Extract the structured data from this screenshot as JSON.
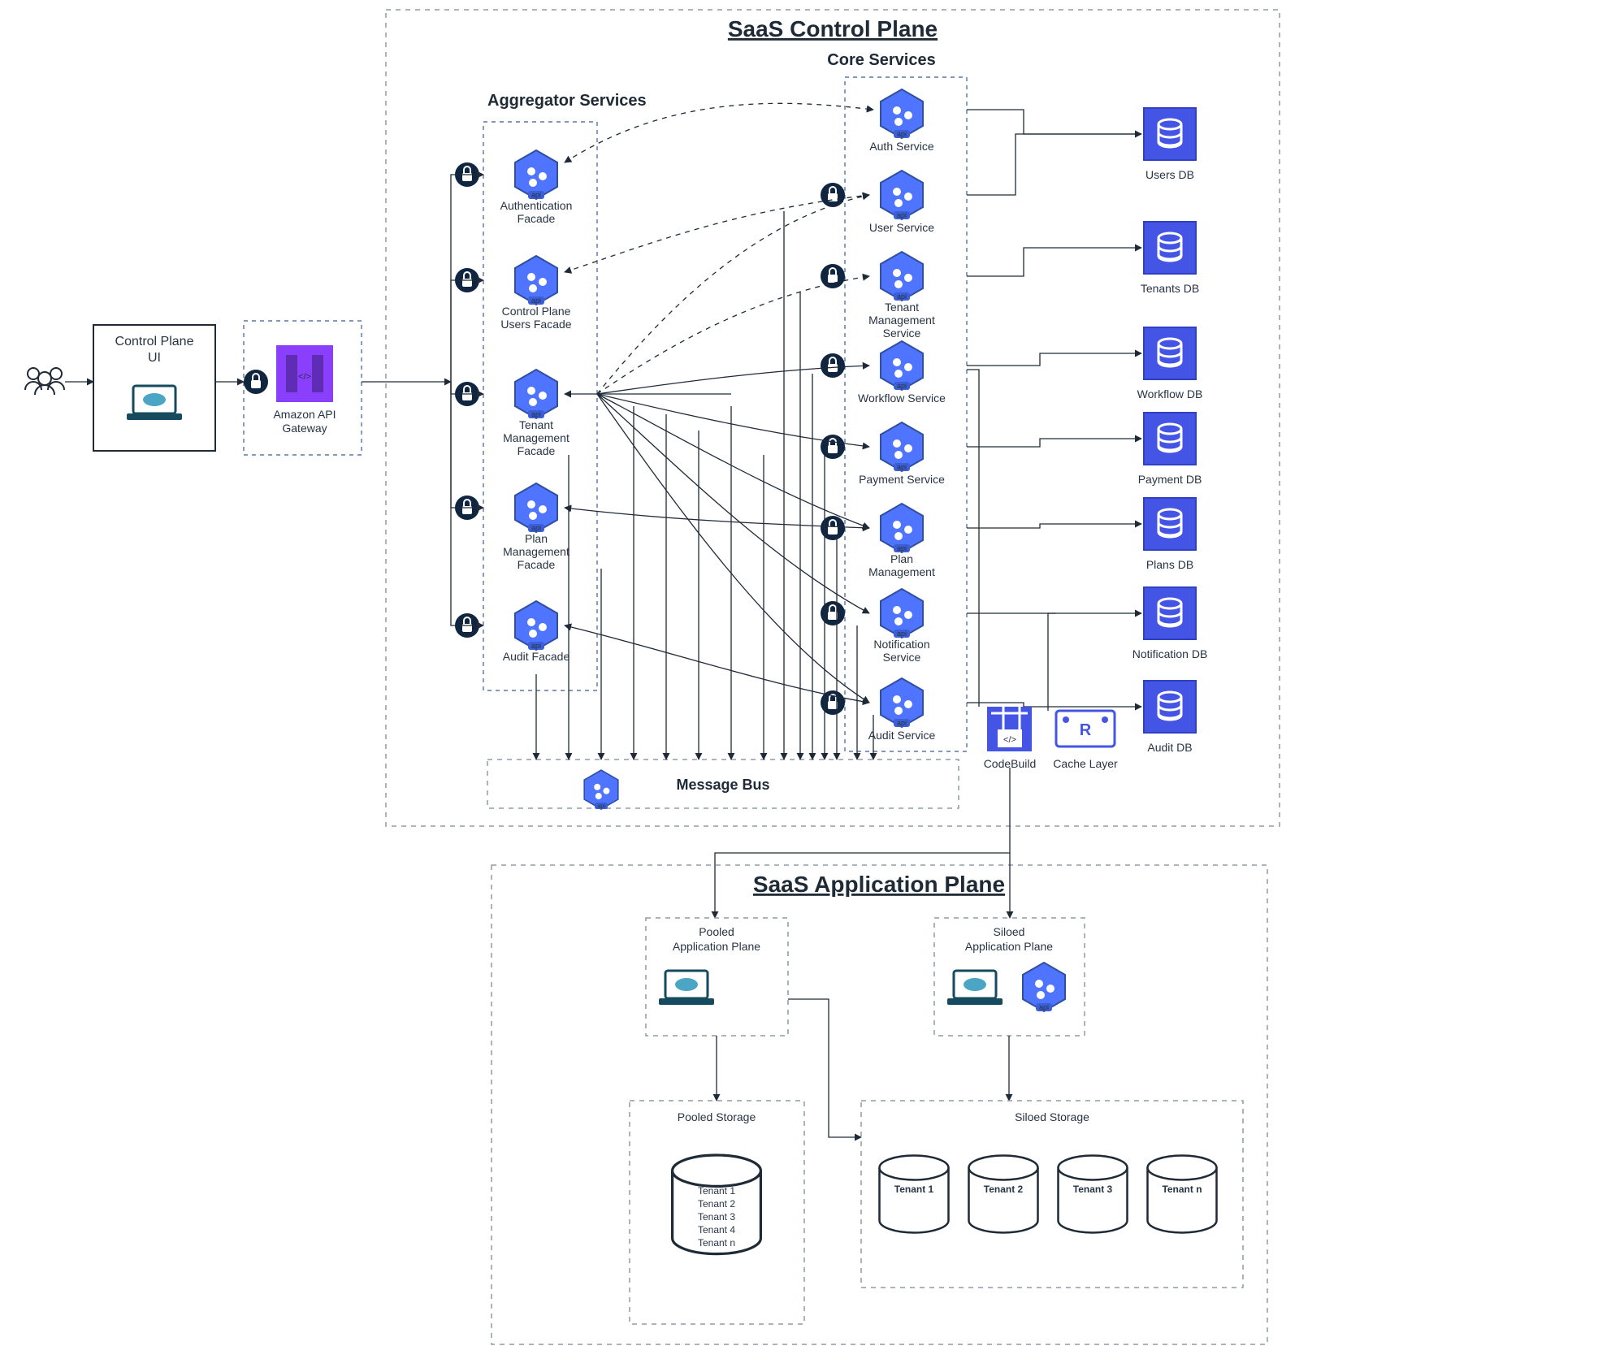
{
  "titles": {
    "control_plane": "SaaS Control Plane",
    "application_plane": "SaaS Application Plane",
    "aggregator": "Aggregator Services",
    "core": "Core Services",
    "message_bus": "Message Bus"
  },
  "left": {
    "ui": "Control Plane\nUI",
    "api_gateway": "Amazon API\nGateway"
  },
  "aggregators": [
    "Authentication\nFacade",
    "Control Plane\nUsers Facade",
    "Tenant\nManagement\nFacade",
    "Plan\nManagement\nFacade",
    "Audit  Facade"
  ],
  "core_services": [
    "Auth Service",
    "User Service",
    "Tenant\nManagement\nService",
    "Workflow Service",
    "Payment Service",
    "Plan\nManagement",
    "Notification\nService",
    "Audit Service"
  ],
  "databases": [
    "Users DB",
    "Tenants DB",
    "Workflow DB",
    "Payment DB",
    "Plans DB",
    "Notification DB",
    "Audit DB"
  ],
  "infra": {
    "codebuild": "CodeBuild",
    "cache": "Cache Layer"
  },
  "app_plane": {
    "pooled": "Pooled\nApplication Plane",
    "siloed": "Siloed\nApplication Plane",
    "pooled_storage": "Pooled Storage",
    "siloed_storage": "Siloed Storage",
    "pooled_tenants": [
      "Tenant 1",
      "Tenant 2",
      "Tenant 3",
      "Tenant 4",
      "Tenant n"
    ],
    "siloed_tenants": [
      "Tenant 1",
      "Tenant 2",
      "Tenant 3",
      "Tenant n"
    ]
  }
}
